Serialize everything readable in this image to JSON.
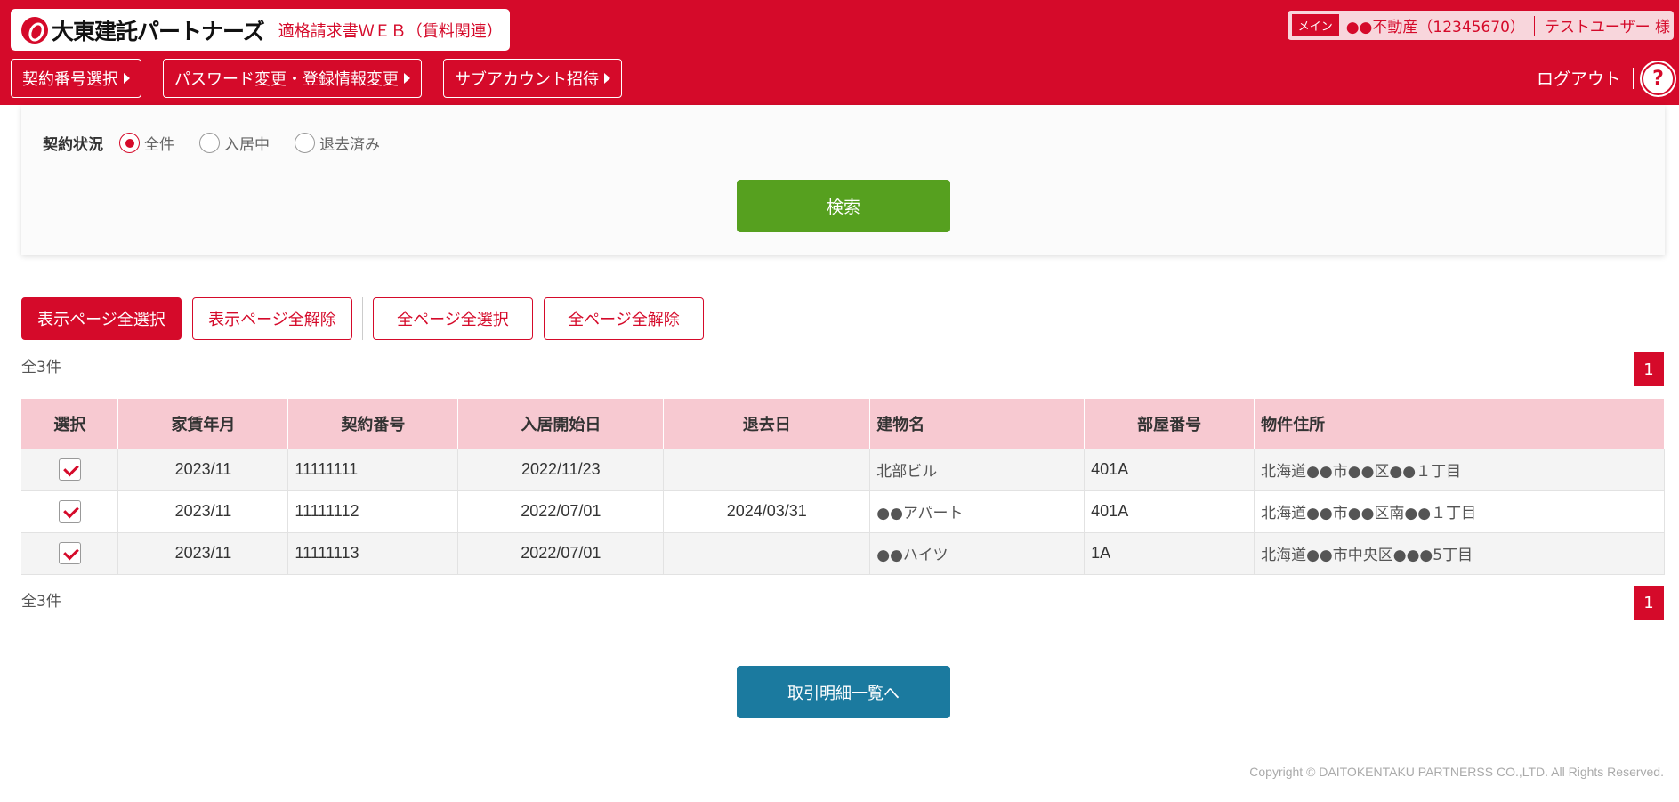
{
  "header": {
    "logo_text": "大東建託パートナーズ",
    "service_name": "適格請求書ＷＥＢ（賃料関連）",
    "badge": "メイン",
    "company": "●●不動産（12345670）",
    "user": "テストユーザー 様",
    "nav": [
      {
        "label": "契約番号選択"
      },
      {
        "label": "パスワード変更・登録情報変更"
      },
      {
        "label": "サブアカウント招待"
      }
    ],
    "logout": "ログアウト",
    "help": "?"
  },
  "search": {
    "status_label": "契約状況",
    "options": [
      {
        "label": "全件",
        "selected": true
      },
      {
        "label": "入居中",
        "selected": false
      },
      {
        "label": "退去済み",
        "selected": false
      }
    ],
    "button": "検索"
  },
  "selection": {
    "select_page": "表示ページ全選択",
    "deselect_page": "表示ページ全解除",
    "select_all": "全ページ全選択",
    "deselect_all": "全ページ全解除"
  },
  "results": {
    "count": "全3件",
    "page": "1"
  },
  "table": {
    "headers": [
      "選択",
      "家賃年月",
      "契約番号",
      "入居開始日",
      "退去日",
      "建物名",
      "部屋番号",
      "物件住所"
    ],
    "rows": [
      {
        "checked": true,
        "rent_month": "2023/11",
        "contract_no": "11111111",
        "move_in": "2022/11/23",
        "move_out": "",
        "building": "北部ビル",
        "room": "401A",
        "address": "北海道●●市●●区●●１丁目"
      },
      {
        "checked": true,
        "rent_month": "2023/11",
        "contract_no": "11111112",
        "move_in": "2022/07/01",
        "move_out": "2024/03/31",
        "building": "●●アパート",
        "room": "401A",
        "address": "北海道●●市●●区南●●１丁目"
      },
      {
        "checked": true,
        "rent_month": "2023/11",
        "contract_no": "11111113",
        "move_in": "2022/07/01",
        "move_out": "",
        "building": "●●ハイツ",
        "room": "1A",
        "address": "北海道●●市中央区●●●5丁目"
      }
    ]
  },
  "footer": {
    "detail_button": "取引明細一覧へ",
    "copyright": "Copyright © DAITOKENTAKU PARTNERSS CO.,LTD. All Rights Reserved."
  }
}
